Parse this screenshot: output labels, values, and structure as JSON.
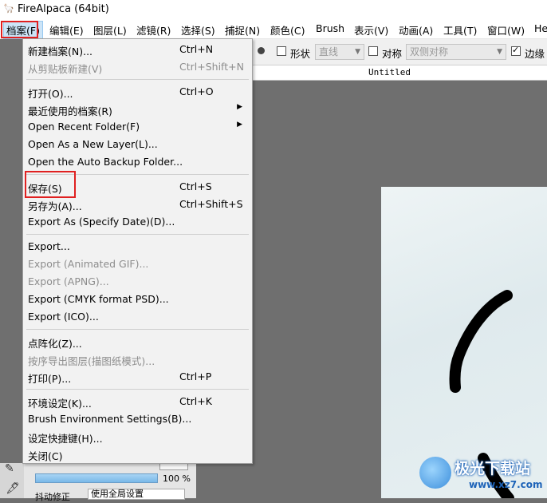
{
  "window": {
    "title": "FireAlpaca (64bit)",
    "icon": "alpaca-app-icon"
  },
  "menubar": [
    "档案(F)",
    "编辑(E)",
    "图层(L)",
    "滤镜(R)",
    "选择(S)",
    "捕捉(N)",
    "颜色(C)",
    "Brush",
    "表示(V)",
    "动画(A)",
    "工具(T)",
    "窗口(W)",
    "Help"
  ],
  "toolbar": {
    "shape_label": "形状",
    "shape_select": "直线",
    "symmetry_label": "对称",
    "symmetry_select": "双侧对称",
    "edge_label": "边缘"
  },
  "canvas": {
    "document_title": "Untitled"
  },
  "file_menu": {
    "items": [
      {
        "label": "新建档案(N)...",
        "shortcut": "Ctrl+N"
      },
      {
        "label": "从剪贴板新建(V)",
        "shortcut": "Ctrl+Shift+N",
        "disabled": true
      },
      {
        "label": "打开(O)...",
        "shortcut": "Ctrl+O"
      },
      {
        "label": "最近使用的档案(R)",
        "submenu": true
      },
      {
        "label": "Open Recent Folder(F)",
        "submenu": true
      },
      {
        "label": "Open As a New Layer(L)..."
      },
      {
        "label": "Open the Auto Backup Folder..."
      },
      {
        "label": "保存(S)",
        "shortcut": "Ctrl+S"
      },
      {
        "label": "另存为(A)...",
        "shortcut": "Ctrl+Shift+S"
      },
      {
        "label": "Export As (Specify Date)(D)..."
      },
      {
        "label": "Export..."
      },
      {
        "label": "Export (Animated GIF)...",
        "disabled": true
      },
      {
        "label": "Export (APNG)...",
        "disabled": true
      },
      {
        "label": "Export (CMYK format PSD)..."
      },
      {
        "label": "Export (ICO)..."
      },
      {
        "label": "点阵化(Z)..."
      },
      {
        "label": "按序导出图层(描图纸模式)...",
        "disabled": true
      },
      {
        "label": "打印(P)...",
        "shortcut": "Ctrl+P"
      },
      {
        "label": "环境设定(K)...",
        "shortcut": "Ctrl+K"
      },
      {
        "label": "Brush Environment Settings(B)..."
      },
      {
        "label": "设定快捷键(H)..."
      },
      {
        "label": "关闭(C)"
      }
    ]
  },
  "left_panel": {
    "opacity_value": "100 %",
    "stabilizer_label": "抖动修正",
    "stabilizer_value": "使用全局设置"
  },
  "watermark": {
    "text": "极光下载站",
    "url": "www.xz7.com"
  },
  "colors": {
    "highlight": "#e02020",
    "menu_bg": "#f2f2f2",
    "workspace": "#6f6f6f",
    "active_menu": "#cce4f7"
  },
  "submenu_arrow": "▶",
  "dropdown_arrow": "▼",
  "checkmark": "✓"
}
